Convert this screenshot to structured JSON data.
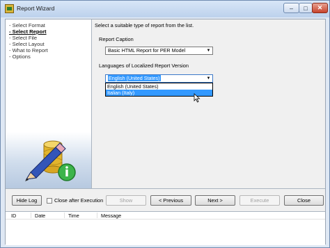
{
  "window": {
    "title": "Report Wizard",
    "min_glyph": "‒",
    "max_glyph": "□",
    "close_glyph": "✕"
  },
  "steps": [
    {
      "label": "- Select Format",
      "active": false
    },
    {
      "label": "- Select Report",
      "active": true
    },
    {
      "label": "- Select File",
      "active": false
    },
    {
      "label": "- Select Layout",
      "active": false
    },
    {
      "label": "- What to Report",
      "active": false
    },
    {
      "label": "- Options",
      "active": false
    }
  ],
  "main": {
    "instruction": "Select a suitable type of report from the list.",
    "caption_label": "Report Caption",
    "caption_value": "Basic HTML Report for PER Model",
    "language_label": "Languages of Localized Report Version",
    "language_value": "English (United States)",
    "language_options": [
      {
        "label": "English (United States)",
        "highlighted": false
      },
      {
        "label": "Italian (Italy)",
        "highlighted": true
      }
    ]
  },
  "buttons": {
    "hide_log": "Hide Log",
    "close_after": "Close after Execution",
    "show": "Show",
    "previous": "< Previous",
    "next": "Next >",
    "execute": "Execute",
    "close": "Close"
  },
  "log": {
    "columns": [
      "ID",
      "Date",
      "Time",
      "Message"
    ]
  },
  "colors": {
    "highlight": "#3399ff",
    "title_bg": "#bcd1ec"
  },
  "icons": [
    "app-icon",
    "pencil-icon",
    "database-icon",
    "info-icon",
    "dropdown-arrow-icon",
    "mouse-cursor-icon"
  ]
}
